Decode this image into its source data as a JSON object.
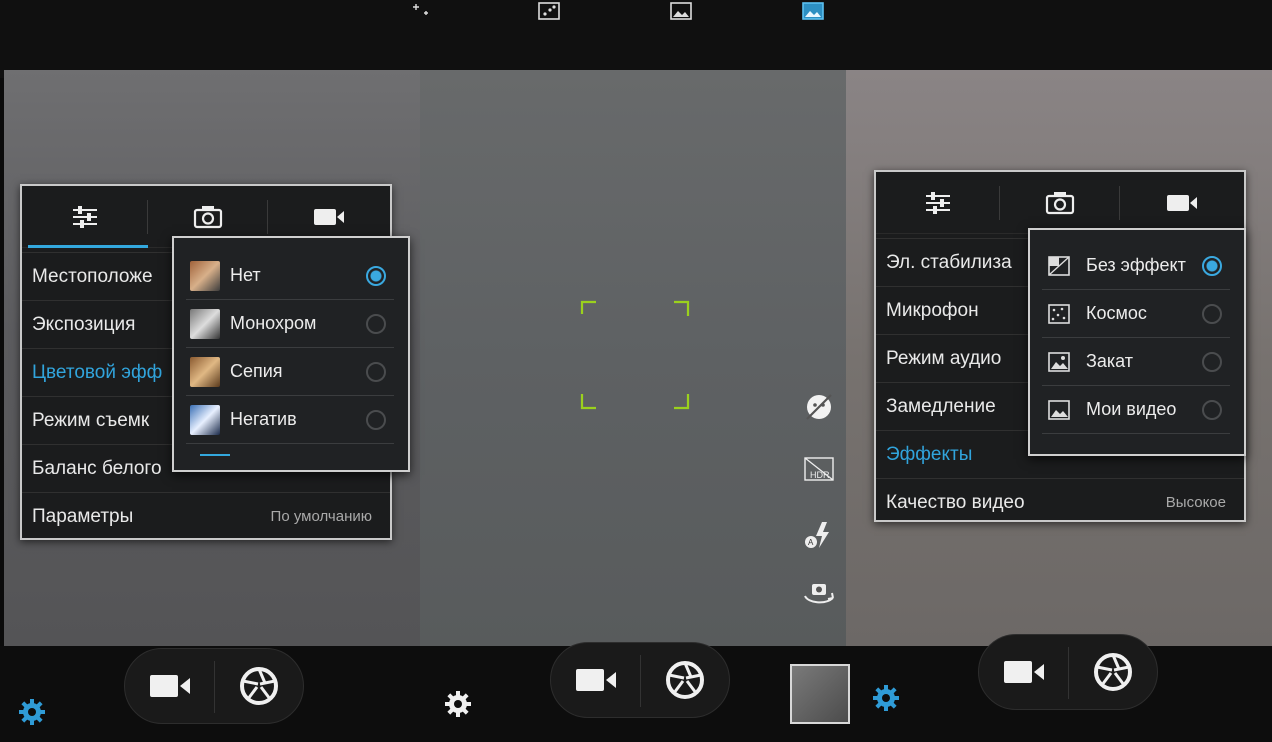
{
  "left_panel": {
    "tabs": [
      {
        "name": "general-settings",
        "active": true
      },
      {
        "name": "camera-settings",
        "active": false
      },
      {
        "name": "video-settings",
        "active": false
      }
    ],
    "rows": [
      {
        "label": "Местоположе",
        "value": ""
      },
      {
        "label": "Экспозиция",
        "value": ""
      },
      {
        "label": "Цветовой эфф",
        "value": "",
        "active": true
      },
      {
        "label": "Режим съемк",
        "value": ""
      },
      {
        "label": "Баланс белого",
        "value": ""
      },
      {
        "label": "Параметры",
        "value": "По умолчанию"
      }
    ],
    "popup": {
      "options": [
        {
          "label": "Нет",
          "selected": true
        },
        {
          "label": "Монохром",
          "selected": false
        },
        {
          "label": "Сепия",
          "selected": false
        },
        {
          "label": "Негатив",
          "selected": false
        }
      ]
    }
  },
  "right_panel": {
    "tabs": [
      {
        "name": "general-settings",
        "active": false
      },
      {
        "name": "camera-settings",
        "active": false
      },
      {
        "name": "video-settings",
        "active": true
      }
    ],
    "rows": [
      {
        "label": "Эл. стабилиза",
        "value": ""
      },
      {
        "label": "Микрофон",
        "value": ""
      },
      {
        "label": "Режим аудио",
        "value": ""
      },
      {
        "label": "Замедление",
        "value": ""
      },
      {
        "label": "Эффекты",
        "value": "",
        "active": true
      },
      {
        "label": "Качество видео",
        "value": "Высокое"
      }
    ],
    "popup": {
      "options": [
        {
          "label": "Без эффект",
          "selected": true,
          "icon": "no-effect-icon"
        },
        {
          "label": "Космос",
          "selected": false,
          "icon": "space-icon"
        },
        {
          "label": "Закат",
          "selected": false,
          "icon": "sunset-icon"
        },
        {
          "label": "Мои видео",
          "selected": false,
          "icon": "my-video-icon"
        }
      ]
    }
  },
  "side_controls": [
    "face-detect-off-icon",
    "hdr-icon",
    "auto-flash-icon",
    "switch-camera-icon"
  ],
  "colors": {
    "accent": "#33a8de",
    "focus": "#9bd11d",
    "panel_bg": "#1b1c1d"
  }
}
